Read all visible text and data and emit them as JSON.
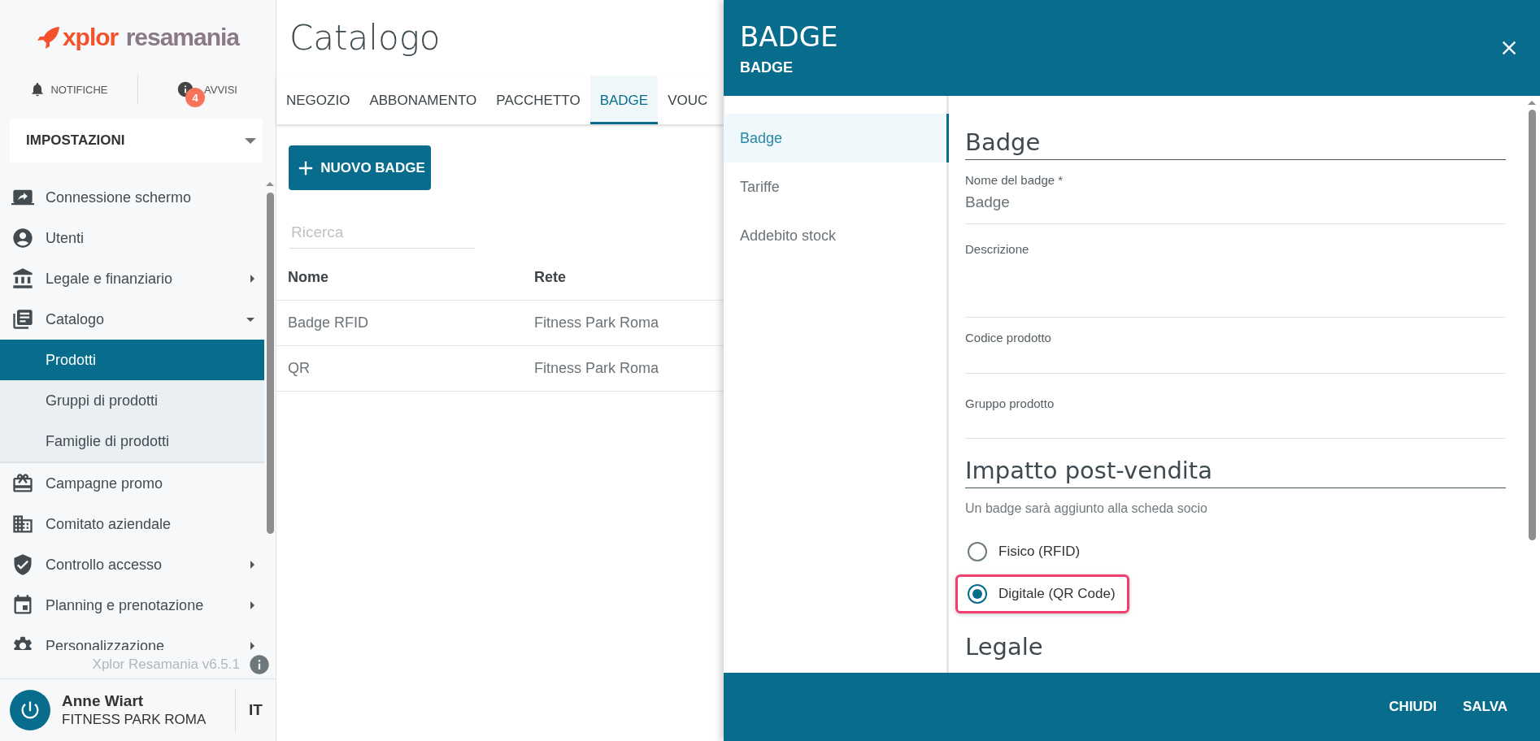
{
  "sidebar": {
    "logo": {
      "brand": "xplor",
      "product": "resamania"
    },
    "notifications": {
      "label": "NOTIFICHE"
    },
    "alerts": {
      "label": "AVVISI",
      "count": "4"
    },
    "section_select": {
      "value": "IMPOSTAZIONI"
    },
    "items": [
      {
        "label": "Connessione schermo",
        "kind": "link"
      },
      {
        "label": "Utenti",
        "kind": "link"
      },
      {
        "label": "Legale e finanziario",
        "kind": "group",
        "expanded": false
      },
      {
        "label": "Catalogo",
        "kind": "group",
        "expanded": true,
        "children": [
          {
            "label": "Prodotti",
            "selected": true
          },
          {
            "label": "Gruppi di prodotti",
            "selected": false
          },
          {
            "label": "Famiglie di prodotti",
            "selected": false
          }
        ]
      },
      {
        "label": "Campagne promo",
        "kind": "link"
      },
      {
        "label": "Comitato aziendale",
        "kind": "link"
      },
      {
        "label": "Controllo accesso",
        "kind": "group",
        "expanded": false
      },
      {
        "label": "Planning e prenotazione",
        "kind": "group",
        "expanded": false
      },
      {
        "label": "Personalizzazione",
        "kind": "group",
        "expanded": false
      }
    ],
    "version": "Xplor Resamania v6.5.1",
    "user": {
      "name": "Anne Wiart",
      "club": "FITNESS PARK ROMA"
    },
    "language": "IT"
  },
  "main": {
    "title": "Catalogo",
    "tabs": [
      {
        "label": "NEGOZIO",
        "selected": false
      },
      {
        "label": "ABBONAMENTO",
        "selected": false
      },
      {
        "label": "PACCHETTO",
        "selected": false
      },
      {
        "label": "BADGE",
        "selected": true
      },
      {
        "label": "VOUC",
        "selected": false
      }
    ],
    "new_button": "NUOVO BADGE",
    "search": {
      "placeholder": "Ricerca"
    },
    "table": {
      "columns": [
        "Nome",
        "Rete"
      ],
      "rows": [
        [
          "Badge RFID",
          "Fitness Park Roma"
        ],
        [
          "QR",
          "Fitness Park Roma"
        ]
      ]
    }
  },
  "panel": {
    "title": "BADGE",
    "subtitle": "BADGE",
    "nav": [
      {
        "label": "Badge",
        "selected": true
      },
      {
        "label": "Tariffe",
        "selected": false
      },
      {
        "label": "Addebito stock",
        "selected": false
      }
    ],
    "badge_section": {
      "heading": "Badge",
      "fields": [
        {
          "label": "Nome del badge *",
          "value": "Badge"
        },
        {
          "label": "Descrizione"
        },
        {
          "label": "Codice prodotto"
        },
        {
          "label": "Gruppo prodotto"
        }
      ]
    },
    "impact_section": {
      "heading": "Impatto post-vendita",
      "hint": "Un badge sarà aggiunto alla scheda socio",
      "options": [
        {
          "label": "Fisico (RFID)",
          "selected": false,
          "highlighted": false
        },
        {
          "label": "Digitale (QR Code)",
          "selected": true,
          "highlighted": true
        }
      ]
    },
    "next_heading": "Legale",
    "footer_buttons": [
      "CHIUDI",
      "SALVA"
    ]
  }
}
